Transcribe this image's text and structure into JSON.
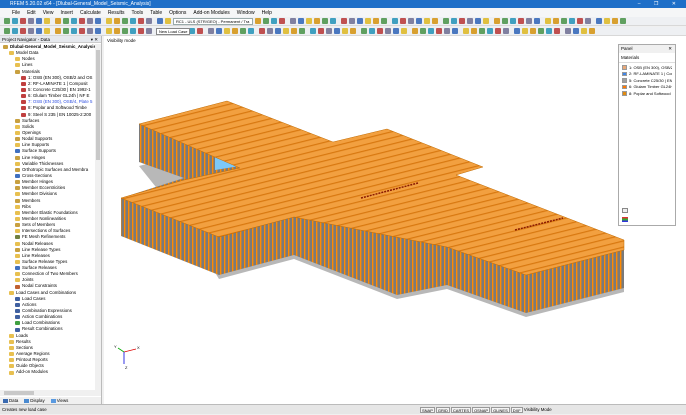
{
  "app": {
    "title": "RFEM 5.20.02 x64 - [Dlubal-General_Model_Seismic_Analysis]",
    "window_controls": "– ❐ ✕"
  },
  "menu": [
    "File",
    "Edit",
    "View",
    "Insert",
    "Calculate",
    "Results",
    "Tools",
    "Table",
    "Options",
    "Add-on Modules",
    "Window",
    "Help"
  ],
  "toolbar": {
    "load_case_combo": "RC1 - ULS (STR/GEO) - Permanent / Tra",
    "tooltip": "New Load Case"
  },
  "navigator": {
    "title": "Project Navigator - Data",
    "pin": "▾ ✕",
    "items": [
      {
        "label": "Dlubal-General_Model_Seismic_Analysis",
        "level": 0,
        "icon": "#c8a040"
      },
      {
        "label": "Model Data",
        "level": 1,
        "icon": "#e8c050"
      },
      {
        "label": "Nodes",
        "level": 2,
        "icon": "#e8c050"
      },
      {
        "label": "Lines",
        "level": 2,
        "icon": "#e8c050"
      },
      {
        "label": "Materials",
        "level": 2,
        "icon": "#c8a040"
      },
      {
        "label": "1: OSB (EN 300), OSB/2 and OS",
        "level": 3,
        "icon": "#c04040"
      },
      {
        "label": "2: RF-LAMINATE 1 | Composit",
        "level": 3,
        "icon": "#c04040"
      },
      {
        "label": "5: Concrete C25/30 | EN 1992-1",
        "level": 3,
        "icon": "#c04040"
      },
      {
        "label": "6: Glulam Timber GL24h | NF E",
        "level": 3,
        "icon": "#c04040"
      },
      {
        "label": "7: OSB (EN 300), OSB/4, Plate 5",
        "level": 3,
        "icon": "#c04040",
        "selected": true
      },
      {
        "label": "8: Poplar and Softwood Timbe",
        "level": 3,
        "icon": "#c04040"
      },
      {
        "label": "9: Steel S 235 | EN 10025-2:200",
        "level": 3,
        "icon": "#c04040"
      },
      {
        "label": "Surfaces",
        "level": 2,
        "icon": "#c8a040"
      },
      {
        "label": "Solids",
        "level": 2,
        "icon": "#e8c050"
      },
      {
        "label": "Openings",
        "level": 2,
        "icon": "#e8c050"
      },
      {
        "label": "Nodal Supports",
        "level": 2,
        "icon": "#c8a040"
      },
      {
        "label": "Line Supports",
        "level": 2,
        "icon": "#e8c050"
      },
      {
        "label": "Surface Supports",
        "level": 2,
        "icon": "#4070c0"
      },
      {
        "label": "Line Hinges",
        "level": 2,
        "icon": "#c8a040"
      },
      {
        "label": "Variable Thicknesses",
        "level": 2,
        "icon": "#e8c050"
      },
      {
        "label": "Orthotropic Surfaces and Membra",
        "level": 2,
        "icon": "#c8a040"
      },
      {
        "label": "Cross-Sections",
        "level": 2,
        "icon": "#4070c0"
      },
      {
        "label": "Member Hinges",
        "level": 2,
        "icon": "#c8a040"
      },
      {
        "label": "Member Eccentricities",
        "level": 2,
        "icon": "#c8a040"
      },
      {
        "label": "Member Divisions",
        "level": 2,
        "icon": "#e8c050"
      },
      {
        "label": "Members",
        "level": 2,
        "icon": "#c8a040"
      },
      {
        "label": "Ribs",
        "level": 2,
        "icon": "#e8c050"
      },
      {
        "label": "Member Elastic Foundations",
        "level": 2,
        "icon": "#e8c050"
      },
      {
        "label": "Member Nonlinearities",
        "level": 2,
        "icon": "#e8c050"
      },
      {
        "label": "Sets of Members",
        "level": 2,
        "icon": "#c8a040"
      },
      {
        "label": "Intersections of Surfaces",
        "level": 2,
        "icon": "#e8c050"
      },
      {
        "label": "FE Mesh Refinements",
        "level": 2,
        "icon": "#708040"
      },
      {
        "label": "Nodal Releases",
        "level": 2,
        "icon": "#e8c050"
      },
      {
        "label": "Line Release Types",
        "level": 2,
        "icon": "#c8a040"
      },
      {
        "label": "Line Releases",
        "level": 2,
        "icon": "#e8c050"
      },
      {
        "label": "Surface Release Types",
        "level": 2,
        "icon": "#e8c050"
      },
      {
        "label": "Surface Releases",
        "level": 2,
        "icon": "#4070c0"
      },
      {
        "label": "Connection of Two Members",
        "level": 2,
        "icon": "#e8c050"
      },
      {
        "label": "Joints",
        "level": 2,
        "icon": "#e8c050"
      },
      {
        "label": "Nodal Constraints",
        "level": 2,
        "icon": "#c06030"
      },
      {
        "label": "Load Cases and Combinations",
        "level": 1,
        "icon": "#e8c050"
      },
      {
        "label": "Load Cases",
        "level": 2,
        "icon": "#4060a0"
      },
      {
        "label": "Actions",
        "level": 2,
        "icon": "#4060a0"
      },
      {
        "label": "Combination Expressions",
        "level": 2,
        "icon": "#4060a0"
      },
      {
        "label": "Action Combinations",
        "level": 2,
        "icon": "#4060a0"
      },
      {
        "label": "Load Combinations",
        "level": 2,
        "icon": "#40a040"
      },
      {
        "label": "Result Combinations",
        "level": 2,
        "icon": "#4060a0"
      },
      {
        "label": "Loads",
        "level": 1,
        "icon": "#e8c050"
      },
      {
        "label": "Results",
        "level": 1,
        "icon": "#e8c050"
      },
      {
        "label": "Sections",
        "level": 1,
        "icon": "#e8c050"
      },
      {
        "label": "Average Regions",
        "level": 1,
        "icon": "#e8c050"
      },
      {
        "label": "Printout Reports",
        "level": 1,
        "icon": "#e8c050"
      },
      {
        "label": "Guide Objects",
        "level": 1,
        "icon": "#e8c050"
      },
      {
        "label": "Add-on Modules",
        "level": 1,
        "icon": "#e8c050"
      }
    ],
    "tabs": [
      "Data",
      "Display",
      "Views"
    ]
  },
  "viewport": {
    "label": "Visibility mode",
    "axes": {
      "x": "X",
      "y": "Y",
      "z": "Z"
    }
  },
  "panel": {
    "title": "Panel",
    "close": "✕",
    "section": "Materials",
    "items": [
      {
        "label": "1: OSB (EN 300), OSB/2",
        "color": "#e8a878"
      },
      {
        "label": "2: RF-LAMINATE 1 | Com",
        "color": "#3f86e8"
      },
      {
        "label": "5: Concrete C25/30 | EN",
        "color": "#a0a0a0"
      },
      {
        "label": "6: Glulam Timber GL24h",
        "color": "#ff7800"
      },
      {
        "label": "8: Poplar and Softwood",
        "color": "#e08a10"
      }
    ]
  },
  "status": {
    "text": "Creates new load case",
    "buttons": [
      "SNAP",
      "GRID",
      "CARTES",
      "OSNAP",
      "GLINES",
      "DXF"
    ],
    "mode": "Visibility Mode"
  },
  "colors": {
    "roof": "#f0962c",
    "wall": "#ff8a00",
    "floor": "#7a7a7a",
    "base": "#b8b8b8",
    "glass": "#7cc8f8",
    "accent": "#1e6fc8"
  }
}
